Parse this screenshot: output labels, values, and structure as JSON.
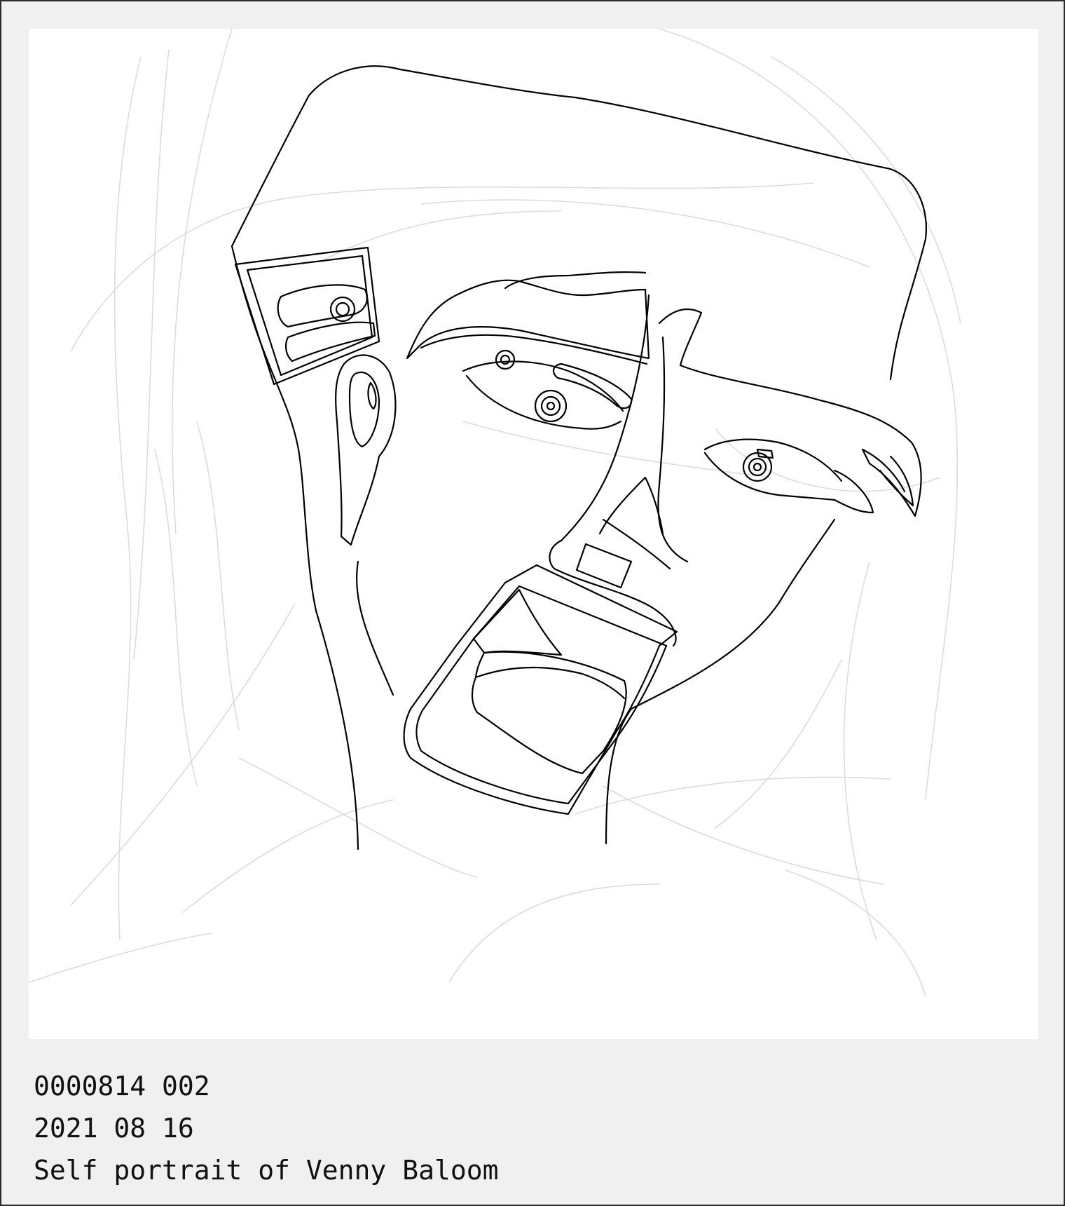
{
  "caption": {
    "id_line": "0000814 002",
    "date_line": "2021 08 16",
    "title_line": "Self portrait of Venny Baloom"
  },
  "colors": {
    "frame": "#f0f0f0",
    "canvas": "#ffffff",
    "ink": "#000000",
    "ghost_lines": "#dcdcdc",
    "border": "#2a2a2a"
  }
}
